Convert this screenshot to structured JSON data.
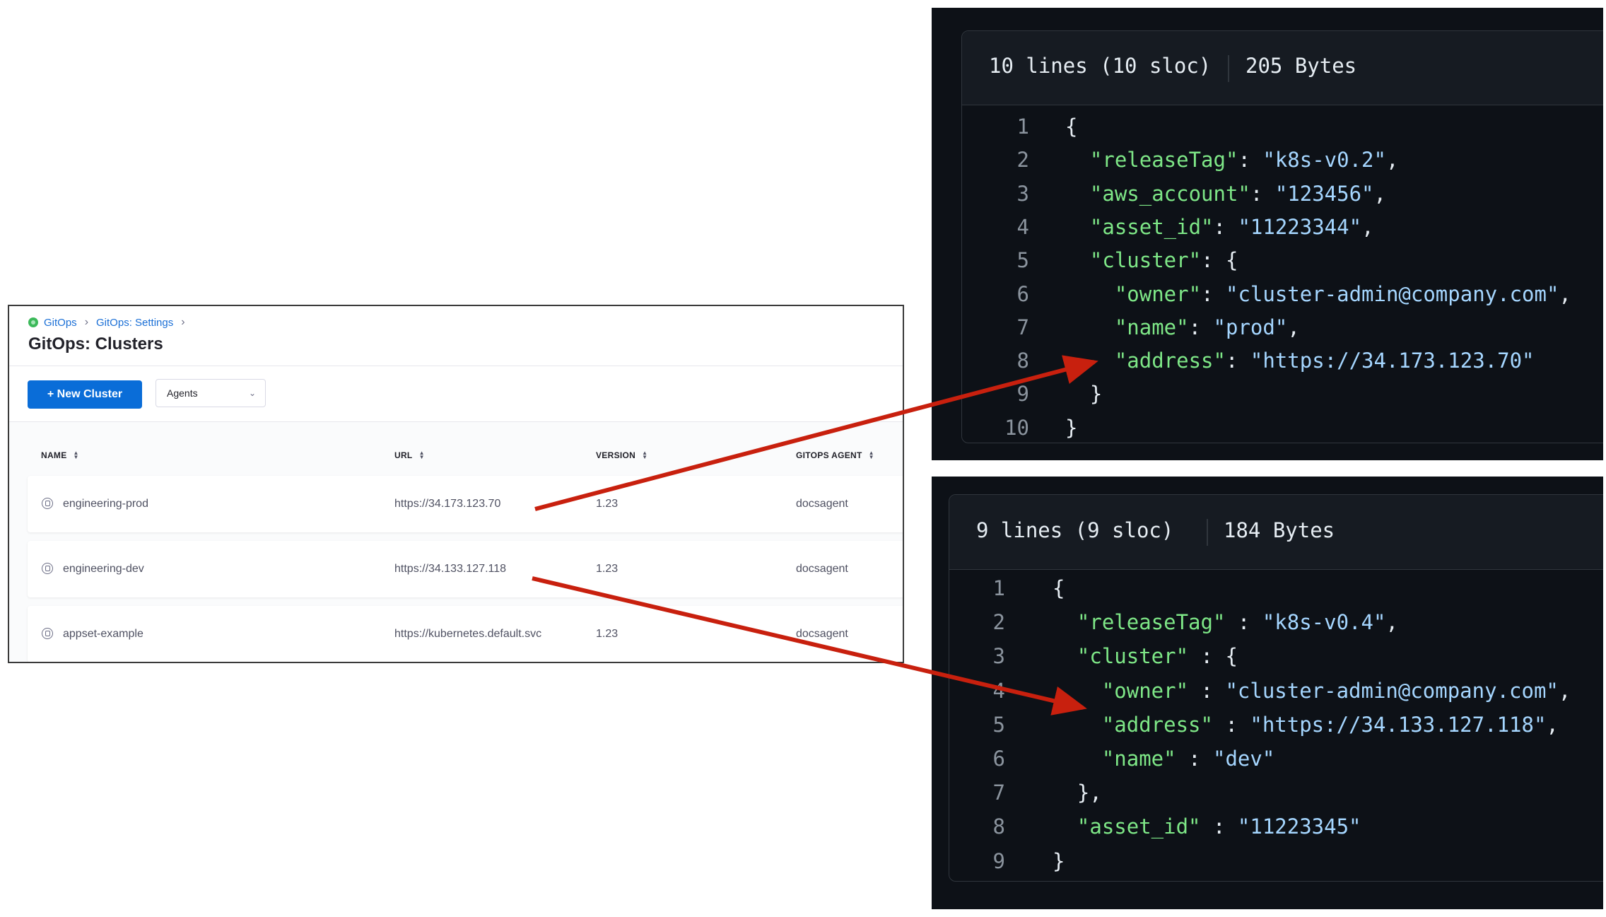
{
  "ui": {
    "breadcrumb": {
      "root": "GitOps",
      "settings": "GitOps: Settings",
      "sep": "›"
    },
    "title": "GitOps: Clusters",
    "toolbar": {
      "new_cluster_label": "+ New Cluster",
      "agents_select_value": "Agents"
    },
    "table": {
      "columns": [
        "NAME",
        "URL",
        "VERSION",
        "GITOPS AGENT"
      ],
      "rows": [
        {
          "name": "engineering-prod",
          "url": "https://34.173.123.70",
          "version": "1.23",
          "agent": "docsagent"
        },
        {
          "name": "engineering-dev",
          "url": "https://34.133.127.118",
          "version": "1.23",
          "agent": "docsagent"
        },
        {
          "name": "appset-example",
          "url": "https://kubernetes.default.svc",
          "version": "1.23",
          "agent": "docsagent"
        }
      ]
    }
  },
  "code_top": {
    "header": {
      "lines": "10 lines (10 sloc)",
      "bytes": "205 Bytes"
    },
    "lines": [
      {
        "n": "1",
        "text": "{"
      },
      {
        "n": "2",
        "text": "  \"releaseTag\": \"k8s-v0.2\","
      },
      {
        "n": "3",
        "text": "  \"aws_account\": \"123456\","
      },
      {
        "n": "4",
        "text": "  \"asset_id\": \"11223344\","
      },
      {
        "n": "5",
        "text": "  \"cluster\": {"
      },
      {
        "n": "6",
        "text": "    \"owner\": \"cluster-admin@company.com\","
      },
      {
        "n": "7",
        "text": "    \"name\": \"prod\","
      },
      {
        "n": "8",
        "text": "    \"address\": \"https://34.173.123.70\""
      },
      {
        "n": "9",
        "text": "  }"
      },
      {
        "n": "10",
        "text": "}"
      }
    ]
  },
  "code_bottom": {
    "header": {
      "lines": "9 lines (9 sloc)",
      "bytes": "184 Bytes"
    },
    "lines": [
      {
        "n": "1",
        "text": "{"
      },
      {
        "n": "2",
        "text": "  \"releaseTag\" : \"k8s-v0.4\","
      },
      {
        "n": "3",
        "text": "  \"cluster\" : {"
      },
      {
        "n": "4",
        "text": "    \"owner\" : \"cluster-admin@company.com\","
      },
      {
        "n": "5",
        "text": "    \"address\" : \"https://34.133.127.118\","
      },
      {
        "n": "6",
        "text": "    \"name\" : \"dev\""
      },
      {
        "n": "7",
        "text": "  },"
      },
      {
        "n": "8",
        "text": "  \"asset_id\" : \"11223345\""
      },
      {
        "n": "9",
        "text": "}"
      }
    ]
  },
  "colors": {
    "key": "#7ee787",
    "string": "#a5d6ff",
    "punct": "#e6edf3",
    "arrow": "#c8200e",
    "primary_button": "#0a6dd8"
  }
}
